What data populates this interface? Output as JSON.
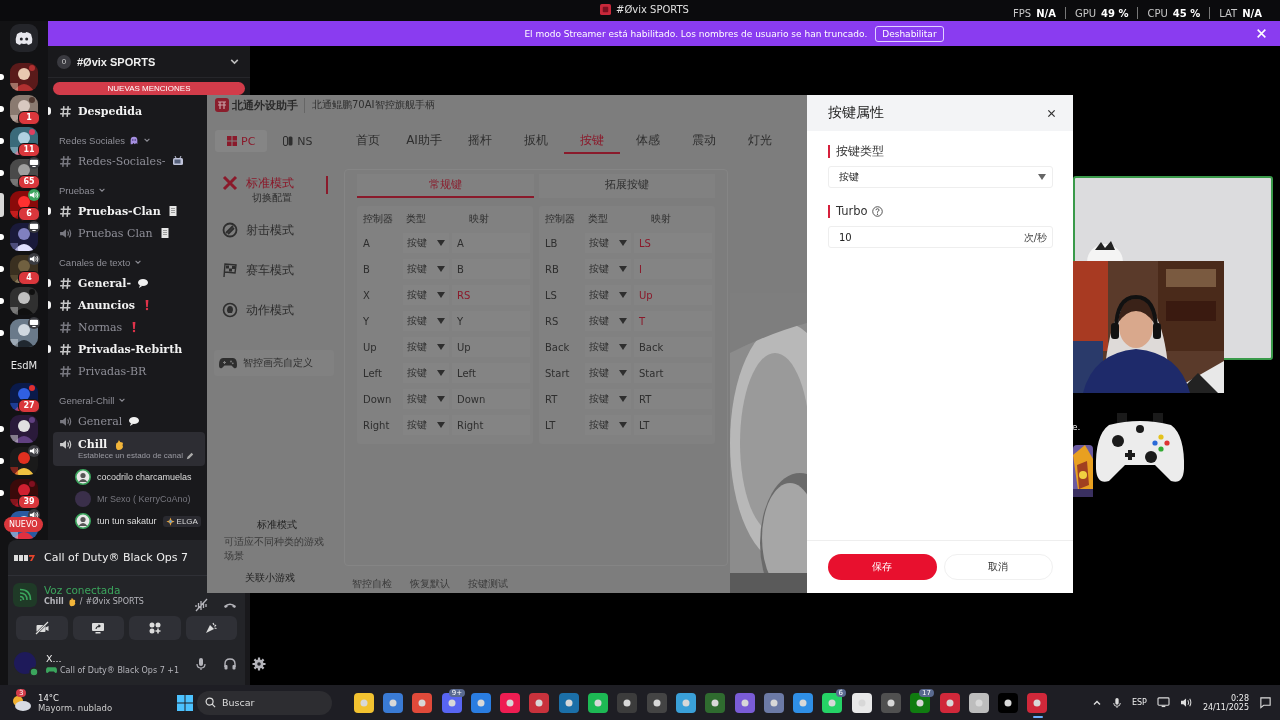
{
  "top_bar": {
    "title": "#Øvix SPORTS",
    "stats": [
      {
        "label": "FPS",
        "value": "N/A"
      },
      {
        "label": "GPU",
        "value": "49 %"
      },
      {
        "label": "CPU",
        "value": "45 %"
      },
      {
        "label": "LAT",
        "value": "N/A"
      }
    ]
  },
  "streamer_banner": {
    "text": "El modo Streamer está habilitado. Los nombres de usuario se han truncado.",
    "button": "Deshabilitar"
  },
  "servers": [
    {
      "kind": "picture",
      "unread": true,
      "selected": false
    },
    {
      "kind": "picture",
      "unread": true,
      "selected": false,
      "badge": "1"
    },
    {
      "kind": "picture",
      "unread": true,
      "selected": false,
      "badge": "11"
    },
    {
      "kind": "picture",
      "unread": true,
      "selected": false,
      "badge": "65"
    },
    {
      "kind": "picture",
      "unread": false,
      "selected": true,
      "badge": "6"
    },
    {
      "kind": "picture",
      "unread": true,
      "selected": false
    },
    {
      "kind": "picture",
      "unread": true,
      "selected": false,
      "badge": "4"
    },
    {
      "kind": "picture",
      "unread": true,
      "selected": false
    },
    {
      "kind": "picture",
      "unread": true,
      "selected": false
    },
    {
      "kind": "label",
      "label": "EsdM",
      "unread": false,
      "selected": false
    },
    {
      "kind": "picture",
      "unread": false,
      "selected": false,
      "badge": "27"
    },
    {
      "kind": "picture",
      "unread": true,
      "selected": false
    },
    {
      "kind": "picture",
      "unread": true,
      "selected": false
    },
    {
      "kind": "picture",
      "unread": true,
      "selected": false,
      "badge": "39"
    },
    {
      "kind": "picture",
      "unread": false,
      "selected": false
    }
  ],
  "new_badge": "NUEVO",
  "server_header": {
    "count": "0",
    "name": "#Øvix SPORTS"
  },
  "mentions_pill": "NUEVAS MENCIONES",
  "channels": [
    {
      "kind": "text",
      "name": "Despedida",
      "unread": true,
      "selected": false
    },
    {
      "kind": "category",
      "name": "Redes Sociales"
    },
    {
      "kind": "text",
      "name": "Redes-Sociales-",
      "unread": false,
      "selected": false
    },
    {
      "kind": "category",
      "name": "Pruebas"
    },
    {
      "kind": "text",
      "name": "Pruebas-Clan",
      "unread": true,
      "selected": false
    },
    {
      "kind": "voice",
      "name": "Pruebas Clan",
      "unread": false,
      "selected": false
    },
    {
      "kind": "category",
      "name": "Canales de texto"
    },
    {
      "kind": "text",
      "name": "General-",
      "unread": true,
      "selected": false
    },
    {
      "kind": "text",
      "name": "Anuncios",
      "unread": true,
      "selected": false
    },
    {
      "kind": "text",
      "name": "Normas",
      "unread": false,
      "selected": false
    },
    {
      "kind": "text",
      "name": "Privadas-Rebirth",
      "unread": true,
      "selected": false
    },
    {
      "kind": "text",
      "name": "Privadas-BR",
      "unread": false,
      "selected": false
    },
    {
      "kind": "category",
      "name": "General-Chill"
    },
    {
      "kind": "voice",
      "name": "General",
      "unread": false,
      "selected": false
    },
    {
      "kind": "voice",
      "name": "Chill",
      "unread": false,
      "selected": true,
      "status": "Establece un estado de canal"
    },
    {
      "kind": "user",
      "name": "cocodrilo charcamuelas",
      "dimmed": false
    },
    {
      "kind": "user",
      "name": "Mr Sexo ( KerryCoAno)",
      "dimmed": true
    },
    {
      "kind": "user",
      "name": "tun tun sakatur",
      "dimmed": false,
      "tag": "ELGA"
    }
  ],
  "activity": {
    "game": "Call of Duty® Black Ops 7"
  },
  "voice": {
    "status": "Voz conectada",
    "channel": "Chill",
    "separator": "/",
    "server": "#Øvix SPORTS"
  },
  "user": {
    "name": "X...",
    "status": "Call of Duty® Black Ops 7 +1"
  },
  "app": {
    "brand": "北通外设助手",
    "model": "北通鲲鹏70AI智控旗舰手柄",
    "platforms": [
      {
        "label": "PC",
        "selected": true
      },
      {
        "label": "NS",
        "selected": false
      }
    ],
    "nav": [
      {
        "label": "首页",
        "selected": false
      },
      {
        "label": "AI助手",
        "selected": false
      },
      {
        "label": "摇杆",
        "selected": false
      },
      {
        "label": "扳机",
        "selected": false
      },
      {
        "label": "按键",
        "selected": true
      },
      {
        "label": "体感",
        "selected": false
      },
      {
        "label": "震动",
        "selected": false
      },
      {
        "label": "灯光",
        "selected": false
      }
    ],
    "modes": [
      {
        "label": "标准模式",
        "selected": true,
        "sublabel": "切换配置"
      },
      {
        "label": "射击模式",
        "selected": false
      },
      {
        "label": "赛车模式",
        "selected": false
      },
      {
        "label": "动作模式",
        "selected": false
      }
    ],
    "custom": "智控画亮自定义",
    "mode_info": {
      "title": "标准模式",
      "description": "可适应不同种类的游戏场景"
    },
    "mini_games": "关联小游戏",
    "key_tabs": [
      {
        "label": "常规键",
        "selected": true
      },
      {
        "label": "拓展按键",
        "selected": false
      }
    ],
    "tables": [
      {
        "columns": [
          "控制器",
          "类型",
          "映射"
        ],
        "rows": [
          {
            "control": "A",
            "type": "按键",
            "mapping": "A",
            "remapped": false
          },
          {
            "control": "B",
            "type": "按键",
            "mapping": "B",
            "remapped": false
          },
          {
            "control": "X",
            "type": "按键",
            "mapping": "RS",
            "remapped": true
          },
          {
            "control": "Y",
            "type": "按键",
            "mapping": "Y",
            "remapped": false
          },
          {
            "control": "Up",
            "type": "按键",
            "mapping": "Up",
            "remapped": false
          },
          {
            "control": "Left",
            "type": "按键",
            "mapping": "Left",
            "remapped": false
          },
          {
            "control": "Down",
            "type": "按键",
            "mapping": "Down",
            "remapped": false
          },
          {
            "control": "Right",
            "type": "按键",
            "mapping": "Right",
            "remapped": false
          }
        ]
      },
      {
        "columns": [
          "控制器",
          "类型",
          "映射"
        ],
        "rows": [
          {
            "control": "LB",
            "type": "按键",
            "mapping": "LS",
            "remapped": true
          },
          {
            "control": "RB",
            "type": "按键",
            "mapping": "I",
            "remapped": true
          },
          {
            "control": "LS",
            "type": "按键",
            "mapping": "Up",
            "remapped": true
          },
          {
            "control": "RS",
            "type": "按键",
            "mapping": "T",
            "remapped": true
          },
          {
            "control": "Back",
            "type": "按键",
            "mapping": "Back",
            "remapped": false
          },
          {
            "control": "Start",
            "type": "按键",
            "mapping": "Start",
            "remapped": false
          },
          {
            "control": "RT",
            "type": "按键",
            "mapping": "RT",
            "remapped": false
          },
          {
            "control": "LT",
            "type": "按键",
            "mapping": "LT",
            "remapped": false
          }
        ]
      }
    ],
    "actions": [
      "智控自检",
      "恢复默认",
      "按键测试"
    ]
  },
  "dialog": {
    "title": "按键属性",
    "type_label": "按键类型",
    "type_value": "按键",
    "turbo_label": "Turbo",
    "turbo_value": "10",
    "turbo_unit": "次/秒",
    "buttons": [
      {
        "label": "保存",
        "kind": "primary"
      },
      {
        "label": "取消",
        "kind": "secondary"
      }
    ]
  },
  "stream": {
    "text": "e."
  },
  "taskbar": {
    "weather": {
      "temp": "14°C",
      "desc": "Mayorm. nublado",
      "badge": "3"
    },
    "search": "Buscar",
    "apps": [
      {
        "color": "#f2c230",
        "selected": false
      },
      {
        "color": "#3a7bd5",
        "selected": false
      },
      {
        "color": "#e04a3a",
        "selected": false
      },
      {
        "color": "#5865f2",
        "selected": false,
        "badge": "9+"
      },
      {
        "color": "#2a7de1",
        "selected": false
      },
      {
        "color": "#ee1d52",
        "selected": false
      },
      {
        "color": "#c8323c",
        "selected": false
      },
      {
        "color": "#1b6fa8",
        "selected": false
      },
      {
        "color": "#1db954",
        "selected": false
      },
      {
        "color": "#3c3c3c",
        "selected": false
      },
      {
        "color": "#444444",
        "selected": false
      },
      {
        "color": "#3aa0d8",
        "selected": false
      },
      {
        "color": "#2f6b2f",
        "selected": false
      },
      {
        "color": "#7a5cd6",
        "selected": false
      },
      {
        "color": "#6c7aa6",
        "selected": false
      },
      {
        "color": "#2f8fe6",
        "selected": false
      },
      {
        "color": "#25d366",
        "selected": false,
        "badge": "6"
      },
      {
        "color": "#e8e8e8",
        "selected": false
      },
      {
        "color": "#505050",
        "selected": false
      },
      {
        "color": "#107c10",
        "selected": false,
        "badge": "17"
      },
      {
        "color": "#d0283a",
        "selected": false
      },
      {
        "color": "#bdbdbd",
        "selected": false
      },
      {
        "color": "#000000",
        "selected": false
      },
      {
        "color": "#d0283a",
        "selected": true
      }
    ],
    "lang": "ESP",
    "time": "0:28",
    "date": "24/11/2025"
  }
}
